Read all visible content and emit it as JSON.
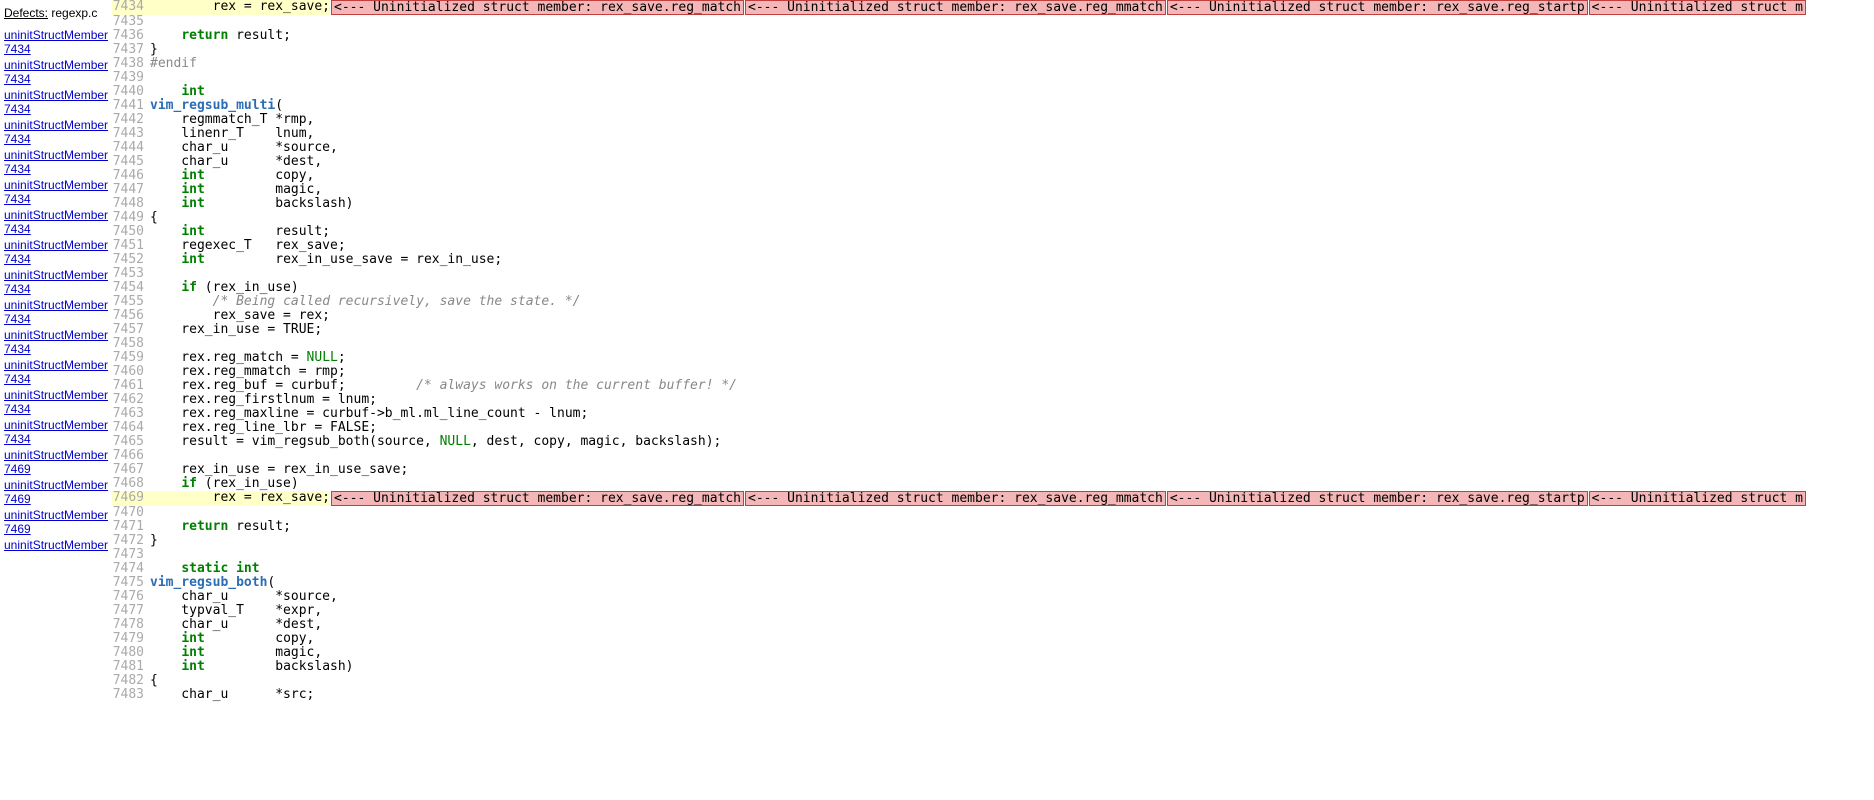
{
  "sidebar": {
    "header_label": "Defects:",
    "header_file": "regexp.c",
    "items": [
      {
        "text": "uninitStructMember 7434"
      },
      {
        "text": "uninitStructMember 7434"
      },
      {
        "text": "uninitStructMember 7434"
      },
      {
        "text": "uninitStructMember 7434"
      },
      {
        "text": "uninitStructMember 7434"
      },
      {
        "text": "uninitStructMember 7434"
      },
      {
        "text": "uninitStructMember 7434"
      },
      {
        "text": "uninitStructMember 7434"
      },
      {
        "text": "uninitStructMember 7434"
      },
      {
        "text": "uninitStructMember 7434"
      },
      {
        "text": "uninitStructMember 7434"
      },
      {
        "text": "uninitStructMember 7434"
      },
      {
        "text": "uninitStructMember 7434"
      },
      {
        "text": "uninitStructMember 7434"
      },
      {
        "text": "uninitStructMember 7469"
      },
      {
        "text": "uninitStructMember 7469"
      },
      {
        "text": "uninitStructMember 7469"
      },
      {
        "text": "uninitStructMember"
      }
    ]
  },
  "defect_annotations": {
    "a": "<--- Uninitialized struct member: rex_save.reg_match",
    "b": "<--- Uninitialized struct member: rex_save.reg_mmatch",
    "c": "<--- Uninitialized struct member: rex_save.reg_startp",
    "d": "<--- Uninitialized struct m"
  },
  "code_lines": [
    {
      "n": 7434,
      "hl": true,
      "tokens": [
        {
          "t": "plain",
          "v": "        rex = rex_save;"
        }
      ],
      "annots": [
        "a",
        "b",
        "c",
        "d"
      ]
    },
    {
      "n": 7435,
      "tokens": []
    },
    {
      "n": 7436,
      "tokens": [
        {
          "t": "plain",
          "v": "    "
        },
        {
          "t": "kw",
          "v": "return"
        },
        {
          "t": "plain",
          "v": " result;"
        }
      ]
    },
    {
      "n": 7437,
      "tokens": [
        {
          "t": "plain",
          "v": "}"
        }
      ]
    },
    {
      "n": 7438,
      "tokens": [
        {
          "t": "pp",
          "v": "#endif"
        }
      ]
    },
    {
      "n": 7439,
      "tokens": []
    },
    {
      "n": 7440,
      "tokens": [
        {
          "t": "plain",
          "v": "    "
        },
        {
          "t": "kw",
          "v": "int"
        }
      ]
    },
    {
      "n": 7441,
      "tokens": [
        {
          "t": "type",
          "v": "vim_regsub_multi"
        },
        {
          "t": "plain",
          "v": "("
        }
      ]
    },
    {
      "n": 7442,
      "tokens": [
        {
          "t": "plain",
          "v": "    regmmatch_T *rmp,"
        }
      ]
    },
    {
      "n": 7443,
      "tokens": [
        {
          "t": "plain",
          "v": "    linenr_T    lnum,"
        }
      ]
    },
    {
      "n": 7444,
      "tokens": [
        {
          "t": "plain",
          "v": "    char_u      *source,"
        }
      ]
    },
    {
      "n": 7445,
      "tokens": [
        {
          "t": "plain",
          "v": "    char_u      *dest,"
        }
      ]
    },
    {
      "n": 7446,
      "tokens": [
        {
          "t": "plain",
          "v": "    "
        },
        {
          "t": "kw",
          "v": "int"
        },
        {
          "t": "plain",
          "v": "         copy,"
        }
      ]
    },
    {
      "n": 7447,
      "tokens": [
        {
          "t": "plain",
          "v": "    "
        },
        {
          "t": "kw",
          "v": "int"
        },
        {
          "t": "plain",
          "v": "         magic,"
        }
      ]
    },
    {
      "n": 7448,
      "tokens": [
        {
          "t": "plain",
          "v": "    "
        },
        {
          "t": "kw",
          "v": "int"
        },
        {
          "t": "plain",
          "v": "         backslash)"
        }
      ]
    },
    {
      "n": 7449,
      "tokens": [
        {
          "t": "plain",
          "v": "{"
        }
      ]
    },
    {
      "n": 7450,
      "tokens": [
        {
          "t": "plain",
          "v": "    "
        },
        {
          "t": "kw",
          "v": "int"
        },
        {
          "t": "plain",
          "v": "         result;"
        }
      ]
    },
    {
      "n": 7451,
      "tokens": [
        {
          "t": "plain",
          "v": "    regexec_T   rex_save;"
        }
      ]
    },
    {
      "n": 7452,
      "tokens": [
        {
          "t": "plain",
          "v": "    "
        },
        {
          "t": "kw",
          "v": "int"
        },
        {
          "t": "plain",
          "v": "         rex_in_use_save = rex_in_use;"
        }
      ]
    },
    {
      "n": 7453,
      "tokens": []
    },
    {
      "n": 7454,
      "tokens": [
        {
          "t": "plain",
          "v": "    "
        },
        {
          "t": "kw",
          "v": "if"
        },
        {
          "t": "plain",
          "v": " (rex_in_use)"
        }
      ]
    },
    {
      "n": 7455,
      "tokens": [
        {
          "t": "plain",
          "v": "        "
        },
        {
          "t": "cmt",
          "v": "/* Being called recursively, save the state. */"
        }
      ]
    },
    {
      "n": 7456,
      "tokens": [
        {
          "t": "plain",
          "v": "        rex_save = rex;"
        }
      ]
    },
    {
      "n": 7457,
      "tokens": [
        {
          "t": "plain",
          "v": "    rex_in_use = TRUE;"
        }
      ]
    },
    {
      "n": 7458,
      "tokens": []
    },
    {
      "n": 7459,
      "tokens": [
        {
          "t": "plain",
          "v": "    rex.reg_match = "
        },
        {
          "t": "const",
          "v": "NULL"
        },
        {
          "t": "plain",
          "v": ";"
        }
      ]
    },
    {
      "n": 7460,
      "tokens": [
        {
          "t": "plain",
          "v": "    rex.reg_mmatch = rmp;"
        }
      ]
    },
    {
      "n": 7461,
      "tokens": [
        {
          "t": "plain",
          "v": "    rex.reg_buf = curbuf;         "
        },
        {
          "t": "cmt",
          "v": "/* always works on the current buffer! */"
        }
      ]
    },
    {
      "n": 7462,
      "tokens": [
        {
          "t": "plain",
          "v": "    rex.reg_firstlnum = lnum;"
        }
      ]
    },
    {
      "n": 7463,
      "tokens": [
        {
          "t": "plain",
          "v": "    rex.reg_maxline = curbuf->b_ml.ml_line_count - lnum;"
        }
      ]
    },
    {
      "n": 7464,
      "tokens": [
        {
          "t": "plain",
          "v": "    rex.reg_line_lbr = FALSE;"
        }
      ]
    },
    {
      "n": 7465,
      "tokens": [
        {
          "t": "plain",
          "v": "    result = vim_regsub_both(source, "
        },
        {
          "t": "const",
          "v": "NULL"
        },
        {
          "t": "plain",
          "v": ", dest, copy, magic, backslash);"
        }
      ]
    },
    {
      "n": 7466,
      "tokens": []
    },
    {
      "n": 7467,
      "tokens": [
        {
          "t": "plain",
          "v": "    rex_in_use = rex_in_use_save;"
        }
      ]
    },
    {
      "n": 7468,
      "tokens": [
        {
          "t": "plain",
          "v": "    "
        },
        {
          "t": "kw",
          "v": "if"
        },
        {
          "t": "plain",
          "v": " (rex_in_use)"
        }
      ]
    },
    {
      "n": 7469,
      "hl": true,
      "tokens": [
        {
          "t": "plain",
          "v": "        rex = rex_save;"
        }
      ],
      "annots": [
        "a",
        "b",
        "c",
        "d"
      ]
    },
    {
      "n": 7470,
      "tokens": []
    },
    {
      "n": 7471,
      "tokens": [
        {
          "t": "plain",
          "v": "    "
        },
        {
          "t": "kw",
          "v": "return"
        },
        {
          "t": "plain",
          "v": " result;"
        }
      ]
    },
    {
      "n": 7472,
      "tokens": [
        {
          "t": "plain",
          "v": "}"
        }
      ]
    },
    {
      "n": 7473,
      "tokens": []
    },
    {
      "n": 7474,
      "tokens": [
        {
          "t": "plain",
          "v": "    "
        },
        {
          "t": "kw",
          "v": "static"
        },
        {
          "t": "plain",
          "v": " "
        },
        {
          "t": "kw",
          "v": "int"
        }
      ]
    },
    {
      "n": 7475,
      "tokens": [
        {
          "t": "type",
          "v": "vim_regsub_both"
        },
        {
          "t": "plain",
          "v": "("
        }
      ]
    },
    {
      "n": 7476,
      "tokens": [
        {
          "t": "plain",
          "v": "    char_u      *source,"
        }
      ]
    },
    {
      "n": 7477,
      "tokens": [
        {
          "t": "plain",
          "v": "    typval_T    *expr,"
        }
      ]
    },
    {
      "n": 7478,
      "tokens": [
        {
          "t": "plain",
          "v": "    char_u      *dest,"
        }
      ]
    },
    {
      "n": 7479,
      "tokens": [
        {
          "t": "plain",
          "v": "    "
        },
        {
          "t": "kw",
          "v": "int"
        },
        {
          "t": "plain",
          "v": "         copy,"
        }
      ]
    },
    {
      "n": 7480,
      "tokens": [
        {
          "t": "plain",
          "v": "    "
        },
        {
          "t": "kw",
          "v": "int"
        },
        {
          "t": "plain",
          "v": "         magic,"
        }
      ]
    },
    {
      "n": 7481,
      "tokens": [
        {
          "t": "plain",
          "v": "    "
        },
        {
          "t": "kw",
          "v": "int"
        },
        {
          "t": "plain",
          "v": "         backslash)"
        }
      ]
    },
    {
      "n": 7482,
      "tokens": [
        {
          "t": "plain",
          "v": "{"
        }
      ]
    },
    {
      "n": 7483,
      "tokens": [
        {
          "t": "plain",
          "v": "    char_u      *src;"
        }
      ]
    }
  ]
}
